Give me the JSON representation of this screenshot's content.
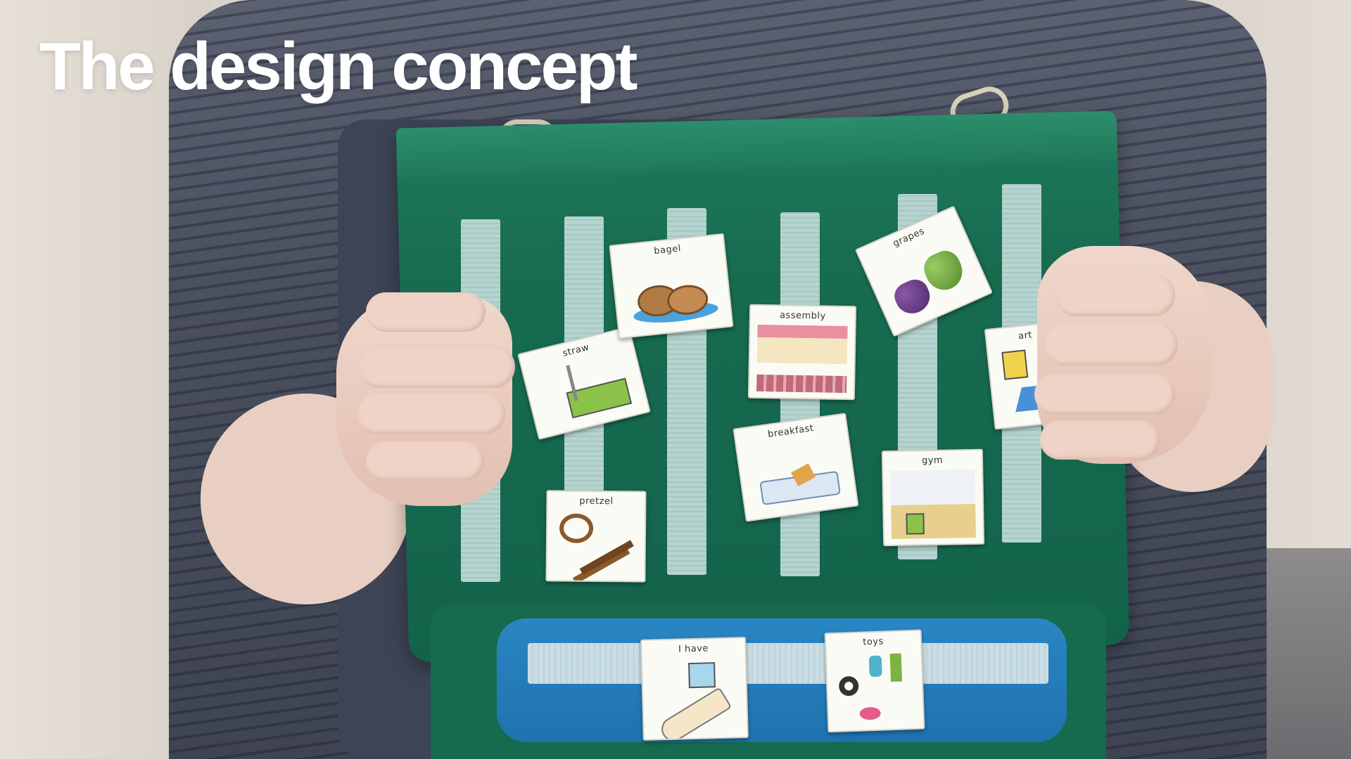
{
  "slide": {
    "title": "The design concept"
  },
  "photo": {
    "description_colors": {
      "board": "#176b4f",
      "strap": "#b5d3cf",
      "band": "#1f72ae",
      "shirt": "#4a4f5e"
    },
    "cards": [
      {
        "label": "straw"
      },
      {
        "label": "bagel"
      },
      {
        "label": "assembly"
      },
      {
        "label": "grapes"
      },
      {
        "label": "art"
      },
      {
        "label": "breakfast"
      },
      {
        "label": "gym"
      },
      {
        "label": "pretzel"
      },
      {
        "label": "I have"
      },
      {
        "label": "toys"
      }
    ]
  }
}
